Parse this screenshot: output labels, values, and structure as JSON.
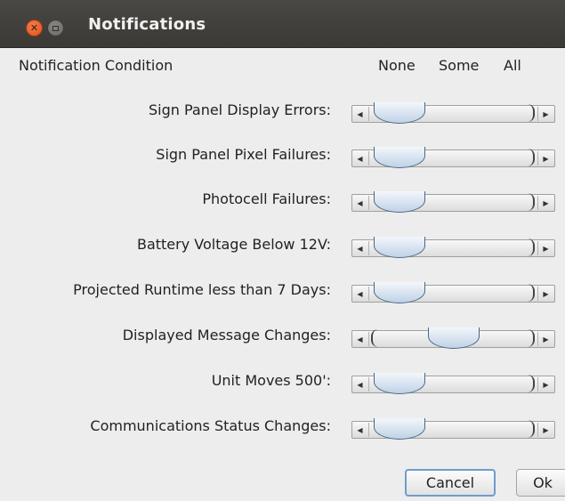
{
  "window": {
    "title": "Notifications"
  },
  "header": {
    "condition_label": "Notification Condition",
    "columns": [
      "None",
      "Some",
      "All"
    ]
  },
  "rows": [
    {
      "label": "Sign Panel Display Errors:",
      "level": "None"
    },
    {
      "label": "Sign Panel Pixel Failures:",
      "level": "None"
    },
    {
      "label": "Photocell Failures:",
      "level": "None"
    },
    {
      "label": "Battery Voltage Below 12V:",
      "level": "None"
    },
    {
      "label": "Projected Runtime less than 7 Days:",
      "level": "None"
    },
    {
      "label": "Displayed Message Changes:",
      "level": "Some"
    },
    {
      "label": "Unit Moves 500':",
      "level": "None"
    },
    {
      "label": "Communications Status Changes:",
      "level": "None"
    }
  ],
  "buttons": {
    "cancel": "Cancel",
    "ok": "Ok"
  },
  "icons": {
    "close": "close-icon",
    "minimize": "minimize-icon",
    "scroll_left": "arrow-left-icon",
    "scroll_right": "arrow-right-icon"
  }
}
